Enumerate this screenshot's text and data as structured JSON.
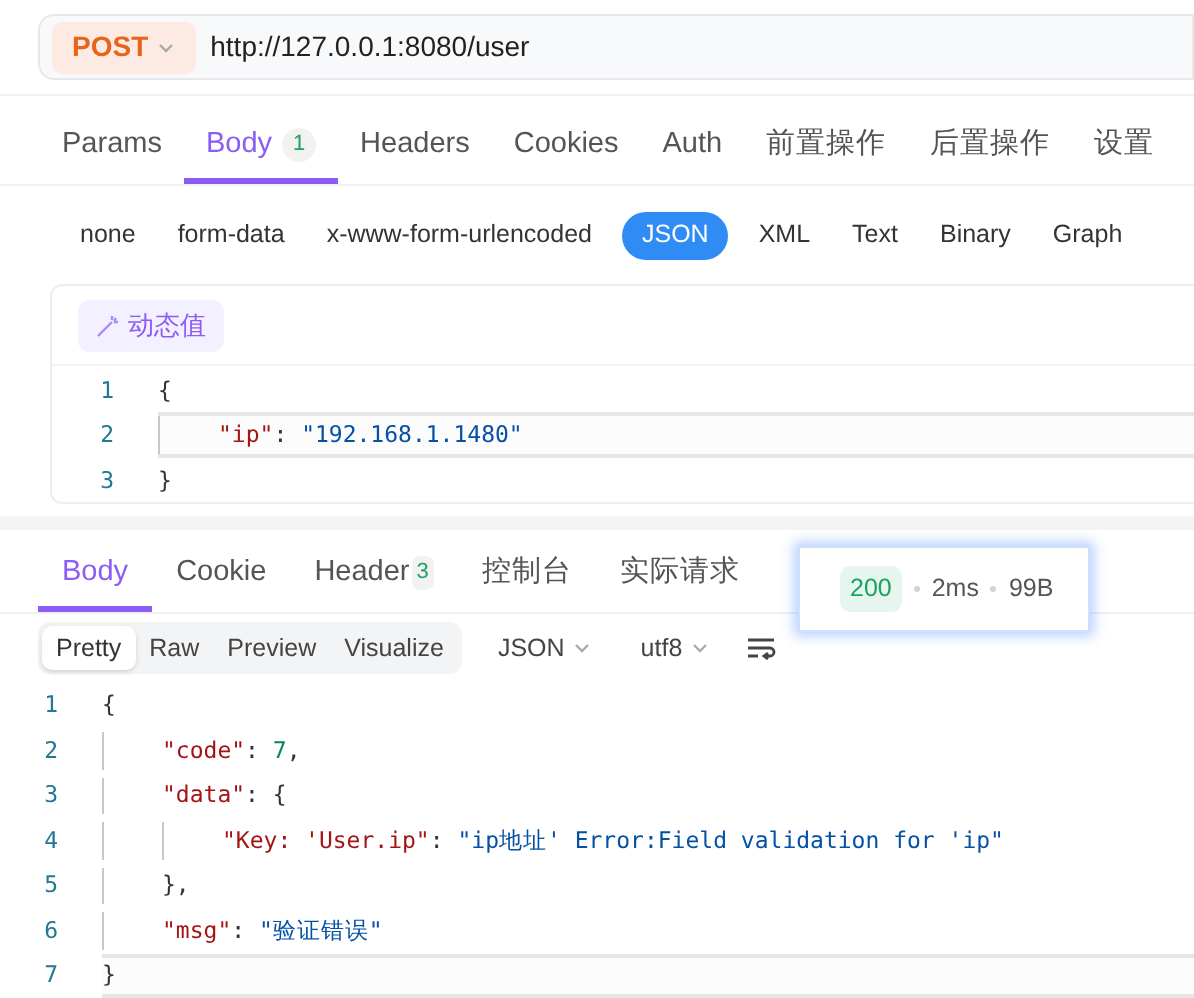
{
  "request": {
    "method": "POST",
    "url": "http://127.0.0.1:8080/user"
  },
  "request_tabs": [
    {
      "label": "Params",
      "selected": false
    },
    {
      "label": "Body",
      "badge": "1",
      "selected": true
    },
    {
      "label": "Headers",
      "selected": false
    },
    {
      "label": "Cookies",
      "selected": false
    },
    {
      "label": "Auth",
      "selected": false
    },
    {
      "label": "前置操作",
      "selected": false
    },
    {
      "label": "后置操作",
      "selected": false
    },
    {
      "label": "设置",
      "selected": false
    }
  ],
  "body_types": [
    {
      "label": "none",
      "selected": false
    },
    {
      "label": "form-data",
      "selected": false
    },
    {
      "label": "x-www-form-urlencoded",
      "selected": false
    },
    {
      "label": "JSON",
      "selected": true
    },
    {
      "label": "XML",
      "selected": false
    },
    {
      "label": "Text",
      "selected": false
    },
    {
      "label": "Binary",
      "selected": false
    },
    {
      "label": "Graph",
      "selected": false
    }
  ],
  "dynamic_value_button": "动态值",
  "request_body": [
    {
      "number": "1",
      "active": false,
      "tokens": [
        {
          "kind": "open",
          "text": "{"
        }
      ]
    },
    {
      "number": "2",
      "active": true,
      "tokens": [
        {
          "kind": "key",
          "text": "\"ip\""
        },
        {
          "kind": "punct",
          "text": ": "
        },
        {
          "kind": "string",
          "text": "\"192.168.1.1480\""
        }
      ]
    },
    {
      "number": "3",
      "active": false,
      "tokens": [
        {
          "kind": "close",
          "text": "}"
        }
      ]
    }
  ],
  "response_tabs": [
    {
      "label": "Body",
      "selected": true
    },
    {
      "label": "Cookie",
      "selected": false
    },
    {
      "label": "Header",
      "badge": "3",
      "selected": false
    },
    {
      "label": "控制台",
      "selected": false
    },
    {
      "label": "实际请求",
      "selected": false
    }
  ],
  "status": {
    "code": "200",
    "time": "2ms",
    "size": "99B"
  },
  "view_modes": [
    {
      "label": "Pretty",
      "selected": true
    },
    {
      "label": "Raw",
      "selected": false
    },
    {
      "label": "Preview",
      "selected": false
    },
    {
      "label": "Visualize",
      "selected": false
    }
  ],
  "format_select": "JSON",
  "encoding_select": "utf8",
  "response_body": [
    {
      "number": "1",
      "active": false,
      "tokens": [
        {
          "kind": "open",
          "text": "{"
        }
      ]
    },
    {
      "number": "2",
      "active": false,
      "tokens": [
        {
          "kind": "key",
          "text": "\"code\""
        },
        {
          "kind": "punct",
          "text": ": "
        },
        {
          "kind": "number",
          "text": "7"
        },
        {
          "kind": "punct",
          "text": ","
        }
      ]
    },
    {
      "number": "3",
      "active": false,
      "tokens": [
        {
          "kind": "key",
          "text": "\"data\""
        },
        {
          "kind": "punct",
          "text": ": "
        },
        {
          "kind": "open",
          "text": "{"
        }
      ]
    },
    {
      "number": "4",
      "active": false,
      "tokens": [
        {
          "kind": "key",
          "text": "\"Key: 'User.ip\""
        },
        {
          "kind": "punct",
          "text": ": "
        },
        {
          "kind": "string",
          "text": "\"ip地址' Error:Field validation for 'ip\""
        }
      ]
    },
    {
      "number": "5",
      "active": false,
      "tokens": [
        {
          "kind": "close",
          "text": "},"
        }
      ]
    },
    {
      "number": "6",
      "active": false,
      "tokens": [
        {
          "kind": "key",
          "text": "\"msg\""
        },
        {
          "kind": "punct",
          "text": ": "
        },
        {
          "kind": "string",
          "text": "\"验证错误\""
        }
      ]
    },
    {
      "number": "7",
      "active": true,
      "tokens": [
        {
          "kind": "close",
          "text": "}"
        }
      ]
    }
  ]
}
